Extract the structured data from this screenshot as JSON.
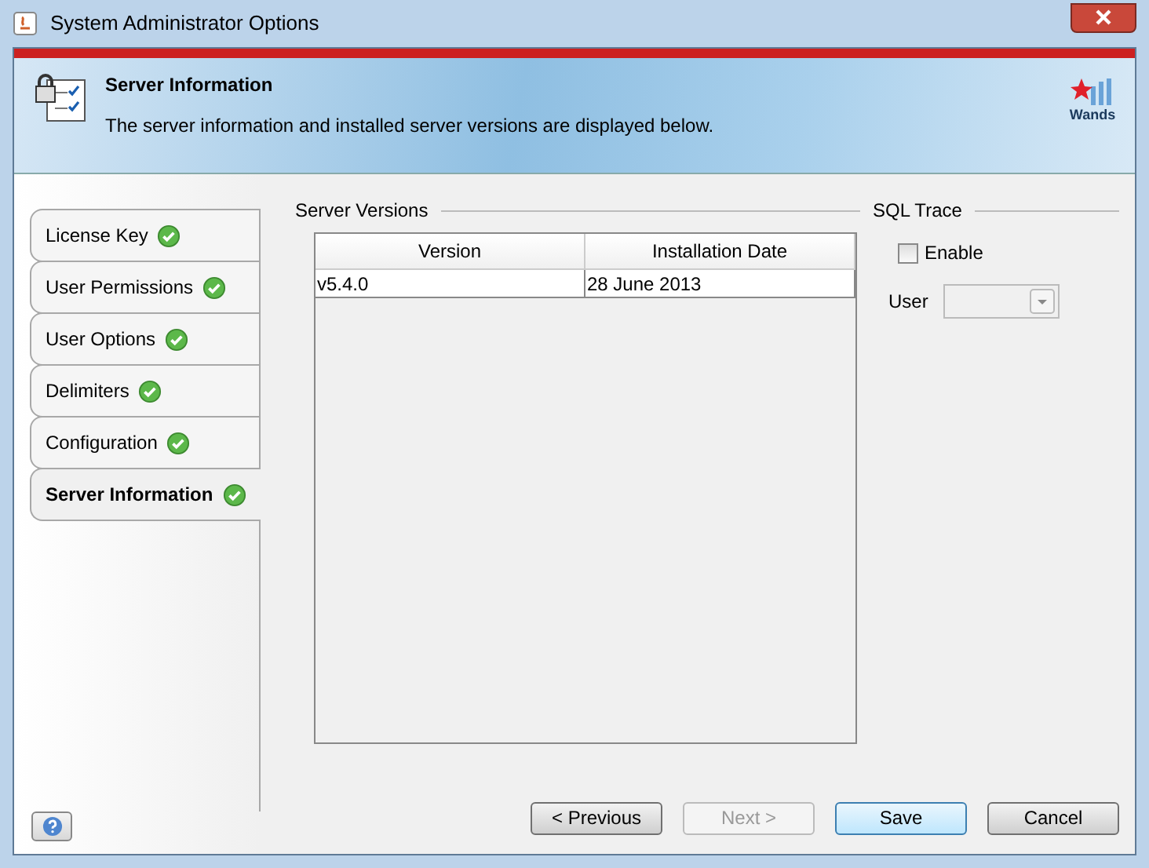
{
  "window": {
    "title": "System Administrator Options"
  },
  "header": {
    "title": "Server Information",
    "description": "The server information and installed server versions are displayed below.",
    "logo_text": "Wands"
  },
  "steps": [
    {
      "label": "License Key",
      "complete": true,
      "selected": false
    },
    {
      "label": "User Permissions",
      "complete": true,
      "selected": false
    },
    {
      "label": "User Options",
      "complete": true,
      "selected": false
    },
    {
      "label": "Delimiters",
      "complete": true,
      "selected": false
    },
    {
      "label": "Configuration",
      "complete": true,
      "selected": false
    },
    {
      "label": "Server Information",
      "complete": true,
      "selected": true
    }
  ],
  "server_versions": {
    "title": "Server Versions",
    "columns": [
      "Version",
      "Installation Date"
    ],
    "rows": [
      [
        "v5.4.0",
        "28 June 2013"
      ]
    ]
  },
  "sql_trace": {
    "title": "SQL Trace",
    "enable": {
      "label": "Enable",
      "checked": false
    },
    "user": {
      "label": "User",
      "disabled": true
    }
  },
  "buttons": [
    {
      "label": "< Previous",
      "disabled": false,
      "default": false
    },
    {
      "label": "Next >",
      "disabled": true,
      "default": false
    },
    {
      "label": "Save",
      "disabled": false,
      "default": true
    },
    {
      "label": "Cancel",
      "disabled": false,
      "default": false
    }
  ]
}
